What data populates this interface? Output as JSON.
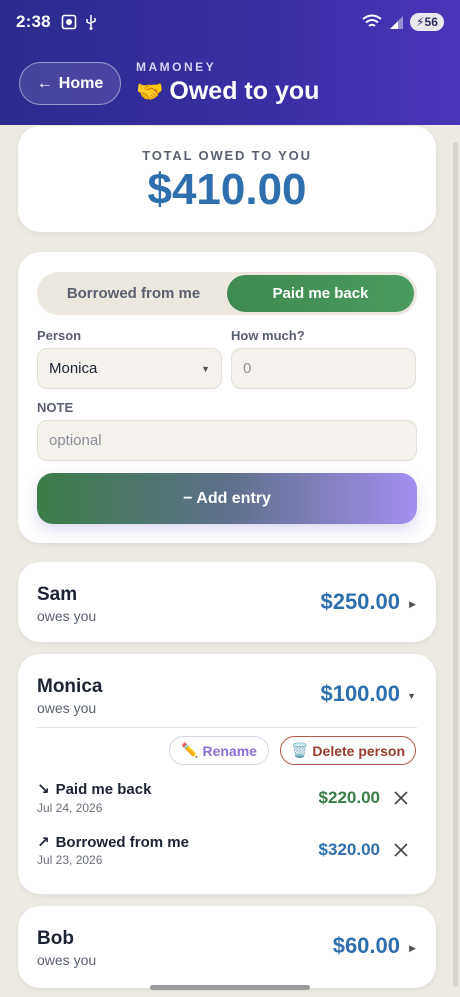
{
  "status": {
    "time": "2:38",
    "battery": "56"
  },
  "header": {
    "home_label": "Home",
    "home_arrow": "←",
    "brand": "MAMONEY",
    "emoji": "🤝",
    "title": "Owed to you"
  },
  "total": {
    "label": "TOTAL OWED TO YOU",
    "value": "$410.00"
  },
  "form": {
    "toggle": {
      "borrowed": "Borrowed from me",
      "paid": "Paid me back",
      "active": "paid"
    },
    "person_label": "Person",
    "person_value": "Monica",
    "amount_label": "How much?",
    "amount_placeholder": "0",
    "note_label": "NOTE",
    "note_placeholder": "optional",
    "add_button": "− Add entry"
  },
  "people": [
    {
      "name": "Sam",
      "sub": "owes you",
      "amount": "$250.00"
    },
    {
      "name": "Monica",
      "sub": "owes you",
      "amount": "$100.00",
      "rename_label": "Rename",
      "delete_label": "Delete person",
      "entries": [
        {
          "arrow": "↘",
          "title": "Paid me back",
          "date": "Jul 24, 2026",
          "amount": "$220.00",
          "color": "#3a7d48"
        },
        {
          "arrow": "↗",
          "title": "Borrowed from me",
          "date": "Jul 23, 2026",
          "amount": "$320.00",
          "color": "#2f6fae"
        }
      ]
    },
    {
      "name": "Bob",
      "sub": "owes you",
      "amount": "$60.00"
    }
  ],
  "colors": {
    "header": "#2c2b8c",
    "accent_blue": "#2f6fae",
    "accent_green": "#3a7d48"
  }
}
